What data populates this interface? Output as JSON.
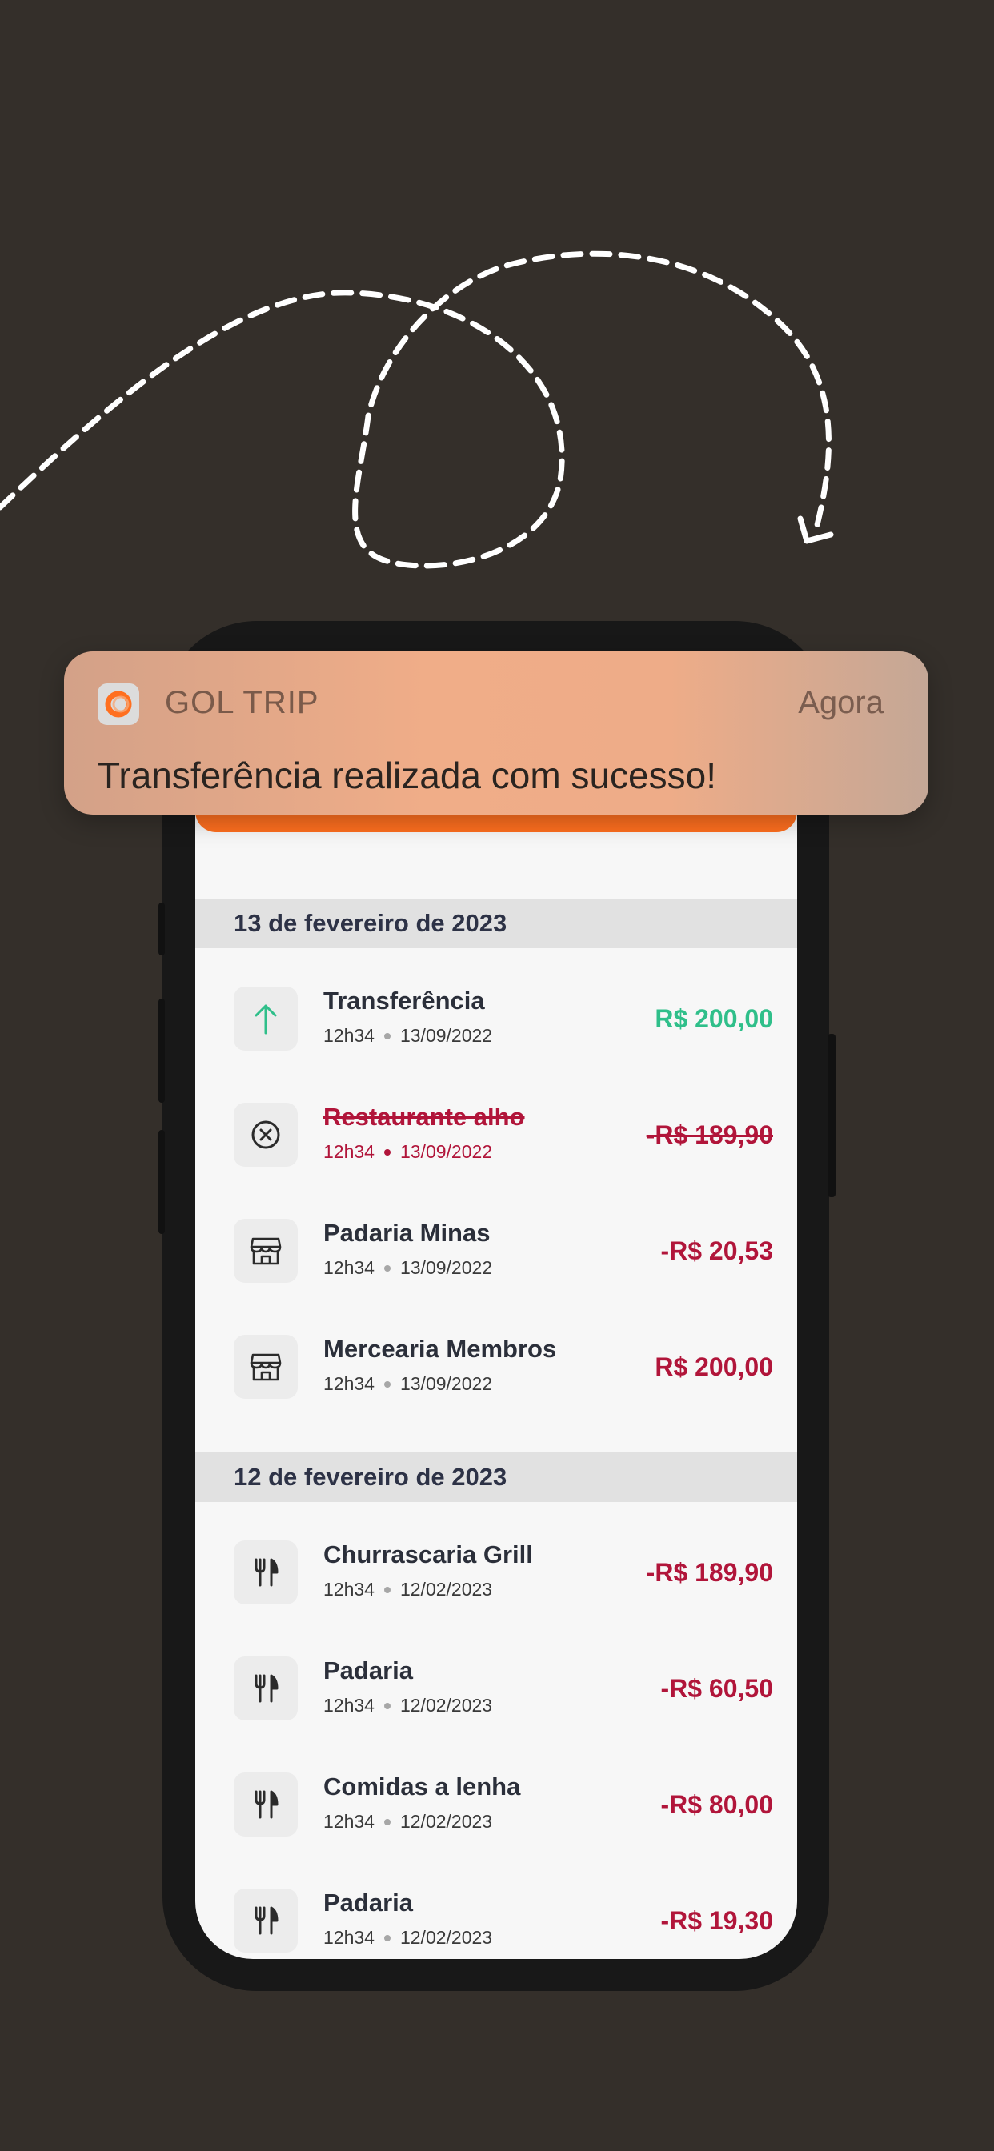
{
  "notification": {
    "app_name": "GOL TRIP",
    "time": "Agora",
    "message": "Transferência realizada com sucesso!",
    "icon": "gol-trip-logo-icon"
  },
  "colors": {
    "background": "#342f2a",
    "accent_orange": "#ff6f1f",
    "positive": "#2fbf8a",
    "negative": "#b1153a"
  },
  "sections": [
    {
      "date": "13 de fevereiro de 2023",
      "transactions": [
        {
          "name": "Transferência",
          "time": "12h34",
          "date": "13/09/2022",
          "amount": "R$ 200,00",
          "icon": "arrow-up-icon",
          "status": "positive"
        },
        {
          "name": "Restaurante alho",
          "time": "12h34",
          "date": "13/09/2022",
          "amount": "-R$ 189,90",
          "icon": "cancel-circle-icon",
          "status": "cancelled"
        },
        {
          "name": "Padaria Minas",
          "time": "12h34",
          "date": "13/09/2022",
          "amount": "-R$ 20,53",
          "icon": "store-icon",
          "status": "negative"
        },
        {
          "name": "Mercearia Membros",
          "time": "12h34",
          "date": "13/09/2022",
          "amount": "R$ 200,00",
          "icon": "store-icon",
          "status": "negative"
        }
      ]
    },
    {
      "date": "12 de fevereiro de 2023",
      "transactions": [
        {
          "name": "Churrascaria Grill",
          "time": "12h34",
          "date": "12/02/2023",
          "amount": "-R$ 189,90",
          "icon": "fork-knife-icon",
          "status": "negative"
        },
        {
          "name": "Padaria",
          "time": "12h34",
          "date": "12/02/2023",
          "amount": "-R$ 60,50",
          "icon": "fork-knife-icon",
          "status": "negative"
        },
        {
          "name": "Comidas a lenha",
          "time": "12h34",
          "date": "12/02/2023",
          "amount": "-R$ 80,00",
          "icon": "fork-knife-icon",
          "status": "negative"
        },
        {
          "name": "Padaria",
          "time": "12h34",
          "date": "12/02/2023",
          "amount": "-R$ 19,30",
          "icon": "fork-knife-icon",
          "status": "negative"
        }
      ]
    }
  ]
}
